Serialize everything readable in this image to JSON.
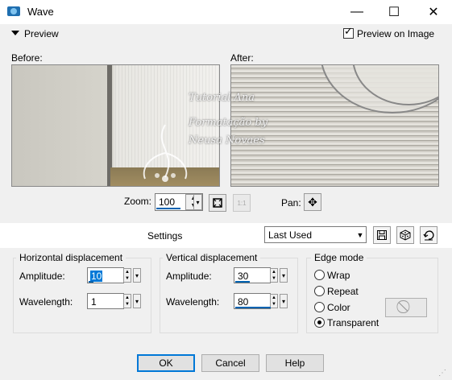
{
  "window": {
    "title": "Wave",
    "minimize_glyph": "—",
    "maximize_glyph": "☐",
    "close_glyph": "✕"
  },
  "preview": {
    "label": "Preview",
    "preview_on_image_label": "Preview on Image",
    "preview_on_image_checked": true,
    "before_label": "Before:",
    "after_label": "After:",
    "watermark_lines": [
      "Tutorial Ana",
      "Formatação by",
      "Neusa Novaes"
    ]
  },
  "zoom": {
    "label": "Zoom:",
    "value": "100",
    "pan_label": "Pan:",
    "fit_icon": "fit-to-window-icon",
    "actual_size_text": "1:1"
  },
  "settings": {
    "label": "Settings",
    "preset_value": "Last Used",
    "save_icon": "save-icon",
    "randomize_icon": "dice-icon",
    "reset_icon": "reset-icon"
  },
  "horizontal": {
    "title": "Horizontal displacement",
    "amplitude_label": "Amplitude:",
    "amplitude_value": "10",
    "wavelength_label": "Wavelength:",
    "wavelength_value": "1"
  },
  "vertical": {
    "title": "Vertical displacement",
    "amplitude_label": "Amplitude:",
    "amplitude_value": "30",
    "wavelength_label": "Wavelength:",
    "wavelength_value": "80"
  },
  "edge_mode": {
    "title": "Edge mode",
    "options": [
      "Wrap",
      "Repeat",
      "Color",
      "Transparent"
    ],
    "selected": "Transparent",
    "color_swatch_icon": "no-color-icon"
  },
  "buttons": {
    "ok": "OK",
    "cancel": "Cancel",
    "help": "Help"
  },
  "colors": {
    "accent": "#0078d7",
    "dialog_bg": "#f0f0f0"
  }
}
